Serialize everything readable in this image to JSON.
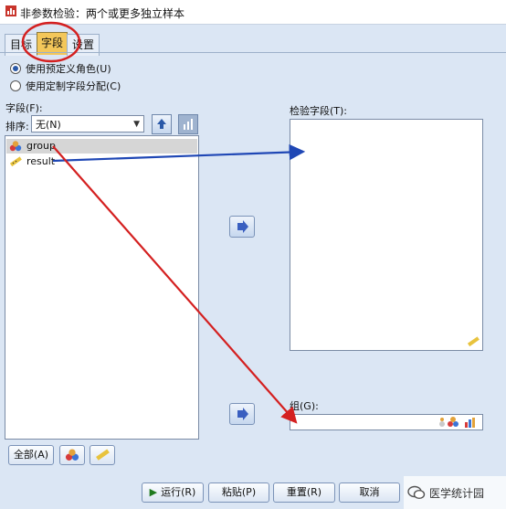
{
  "window": {
    "title": "非参数检验：两个或更多独立样本"
  },
  "tabs": [
    {
      "label": "目标"
    },
    {
      "label": "字段"
    },
    {
      "label": "设置"
    }
  ],
  "options": {
    "predefined_roles": "使用预定义角色(U)",
    "custom_assign": "使用定制字段分配(C)"
  },
  "fields": {
    "label": "字段(F):",
    "sort_label": "排序:",
    "sort_value": "无(N)",
    "items": [
      {
        "name": "group",
        "icon": "nominal-icon"
      },
      {
        "name": "result",
        "icon": "scale-ruler-icon"
      }
    ],
    "all_button": "全部(A)"
  },
  "test_fields": {
    "label": "检验字段(T):"
  },
  "group": {
    "label": "组(G):"
  },
  "buttons": {
    "run": "运行(R)",
    "paste": "粘贴(P)",
    "reset": "重置(R)",
    "cancel": "取消"
  },
  "watermark": "医学统计园",
  "colors": {
    "accent_tab": "#f3c75a",
    "annotation_red": "#d42020",
    "annotation_blue": "#1f47b5"
  }
}
